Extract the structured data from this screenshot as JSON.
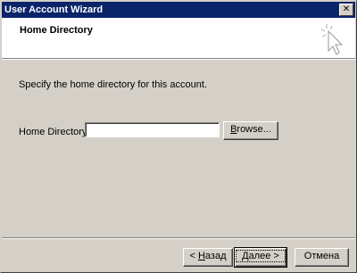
{
  "window": {
    "title": "User Account Wizard",
    "close_glyph": "✕",
    "icons": {
      "close": "close-icon",
      "wizard": "wizard-sparkle-icon"
    },
    "colors": {
      "titlebar": "#0a246a",
      "face": "#d4d0c8",
      "header_bg": "#ffffff"
    }
  },
  "header": {
    "heading": "Home Directory"
  },
  "body": {
    "instructions": "Specify the home directory for this account.",
    "home_directory_label": "Home Directory:",
    "home_directory_value": "",
    "browse_label_mnemonic": "B",
    "browse_label_rest": "rowse..."
  },
  "footer": {
    "back_prefix": "< ",
    "back_mnemonic": "Н",
    "back_rest": "азад",
    "next_mnemonic": "Д",
    "next_rest": "алее >",
    "cancel_label": "Отмена"
  }
}
